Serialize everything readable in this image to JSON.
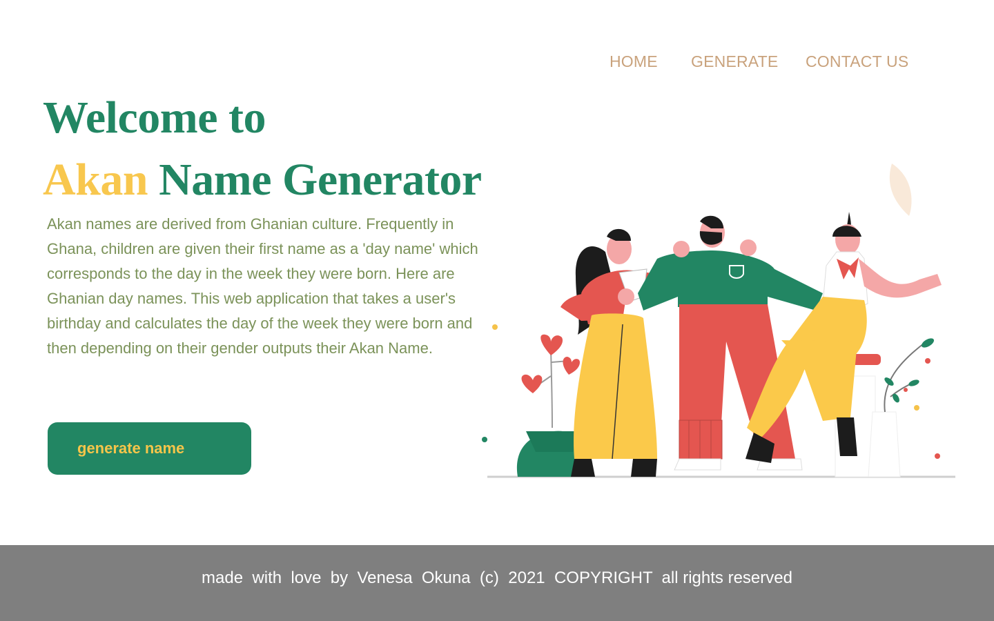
{
  "nav": {
    "home": "HOME",
    "generate": "GENERATE",
    "contact": "CONTACT US"
  },
  "hero": {
    "title_line1": "Welcome to",
    "title_accent": "Akan",
    "title_rest": " Name Generator",
    "description": "Akan names are derived from Ghanian culture. Frequently in Ghana, children are given their first name as a 'day name' which corresponds to the day in the week they were born. Here are Ghanian day names.  This web application that takes a user's birthday and calculates the day of the week they were born and then depending on their gender outputs their Akan Name.",
    "cta_label": "generate name"
  },
  "footer": {
    "text": "made  with  love  by  Venesa  Okuna  (c)  2021  COPYRIGHT  all rights reserved"
  },
  "colors": {
    "primary_green": "#228663",
    "accent_yellow": "#f8c74e",
    "nav_tan": "#c9a27c",
    "body_olive": "#7b9259",
    "footer_gray": "#7f7f7f"
  }
}
